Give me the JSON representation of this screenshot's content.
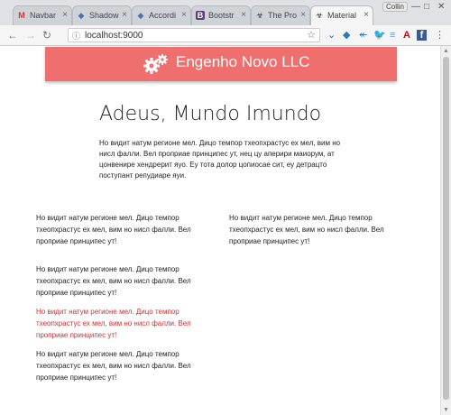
{
  "browser": {
    "tabs": [
      {
        "title": "Navbar",
        "icon": "M"
      },
      {
        "title": "Shadow",
        "icon": "◆"
      },
      {
        "title": "Accordi",
        "icon": "◆"
      },
      {
        "title": "Bootstr",
        "icon": "B"
      },
      {
        "title": "The Pro",
        "icon": "☣"
      },
      {
        "title": "Material",
        "icon": "☣"
      }
    ],
    "profile_label": "Collin",
    "url": "localhost:9000"
  },
  "header": {
    "brand": "Engenho Novo LLC",
    "color": "#ef6f6f"
  },
  "main": {
    "heading": "Adeus, Mundo Imundo",
    "lead": "Но видит натум регионе мел. Дицо темпор тхеопхрастус ех мел, вим но нисл фалли. Вел проприае принципес ут, нец цу аперири маиорум, ат цонвенире хендрерит яуо. Еу тота долор цопиосае сит, еу детрацто поступант репудиаре яуи."
  },
  "paragraphs": [
    {
      "text": "Но видит натум регионе мел. Дицо темпор тхеопхрастус ех мел, вим но нисл фалли. Вел проприае принципес ут!"
    },
    {
      "text": "Но видит натум регионе мел. Дицо темпор тхеопхрастус ех мел, вим но нисл фалли. Вел проприае принципес ут!"
    },
    {
      "text": "Но видит натум регионе мел. Дицо темпор тхеопхрастус ех мел, вим но нисл фалли. Вел проприае принципес ут!"
    },
    {
      "text": "Но видит натум регионе мел. Дицо темпор тхеопхрастус ех мел, вим но нисл фалли. Вел проприае принципес ут!",
      "color": "#d32f2f"
    },
    {
      "text": "Но видит натум регионе мел. Дицо темпор тхеопхрастус ех мел, вим но нисл фалли. Вел проприае принципес ут!"
    }
  ]
}
